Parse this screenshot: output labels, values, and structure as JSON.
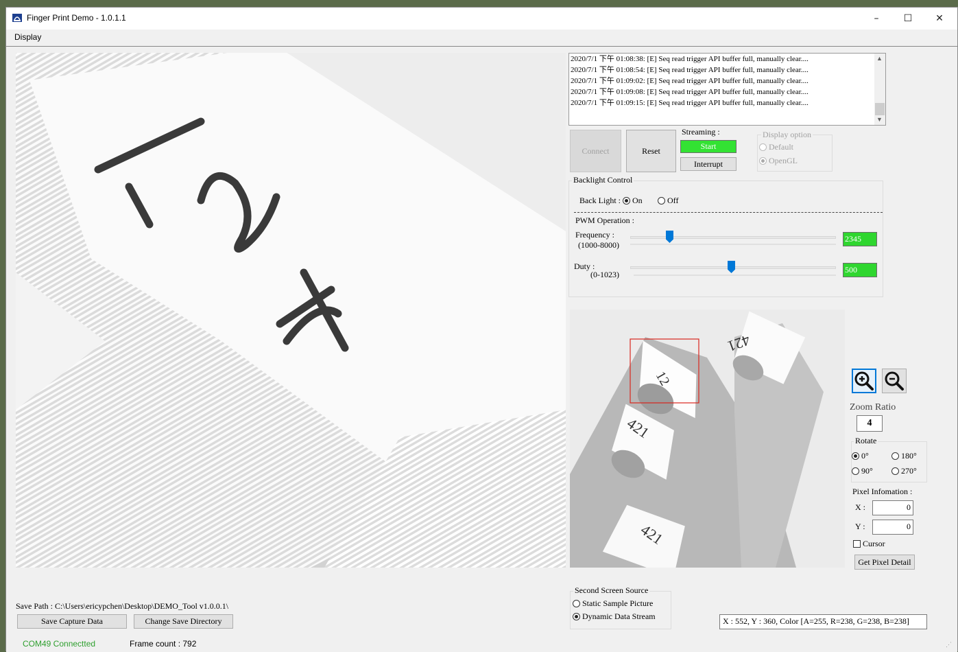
{
  "window": {
    "title": "Finger Print Demo - 1.0.1.1",
    "minimize": "–",
    "maximize": "☐",
    "close": "✕"
  },
  "menu": {
    "display": "Display"
  },
  "log": {
    "lines": [
      "2020/7/1 下午 01:08:38: [E] Seq read trigger API buffer full, manually clear....",
      "2020/7/1 下午 01:08:54: [E] Seq read trigger API buffer full, manually clear....",
      "2020/7/1 下午 01:09:02: [E] Seq read trigger API buffer full, manually clear....",
      "2020/7/1 下午 01:09:08: [E] Seq read trigger API buffer full, manually clear....",
      "2020/7/1 下午 01:09:15: [E] Seq read trigger API buffer full, manually clear...."
    ]
  },
  "controls": {
    "connect": "Connect",
    "reset": "Reset",
    "streaming_label": "Streaming :",
    "start": "Start",
    "interrupt": "Interrupt",
    "display_option_label": "Display option",
    "display_default": "Default",
    "display_opengl": "OpenGL"
  },
  "backlight": {
    "group_label": "Backlight Control",
    "label": "Back Light :",
    "on": "On",
    "off": "Off",
    "selected": "On"
  },
  "pwm": {
    "label": "PWM Operation :",
    "frequency_label": "Frequency :",
    "frequency_range": "(1000-8000)",
    "frequency_value": "2345",
    "frequency_level": 0.19,
    "duty_label": "Duty :",
    "duty_range": "(0-1023)",
    "duty_value": "500",
    "duty_level": 0.49
  },
  "thumbnail_labels": [
    "12",
    "421",
    "421",
    "421"
  ],
  "main_labels": [
    "1",
    "2",
    "4"
  ],
  "zoom": {
    "ratio_label": "Zoom Ratio",
    "ratio_value": "4"
  },
  "rotate": {
    "label": "Rotate",
    "options": [
      "0°",
      "180°",
      "90°",
      "270°"
    ],
    "selected": "0°"
  },
  "pixel": {
    "label": "Pixel Infomation :",
    "x_label": "X :",
    "x_value": "0",
    "y_label": "Y :",
    "y_value": "0",
    "cursor_label": "Cursor",
    "get_detail": "Get Pixel Detail"
  },
  "second_screen": {
    "label": "Second Screen Source",
    "static": "Static Sample Picture",
    "dynamic": "Dynamic Data Stream",
    "selected": "Dynamic Data Stream"
  },
  "save": {
    "path": "Save Path : C:\\Users\\ericypchen\\Desktop\\DEMO_Tool v1.0.0.1\\",
    "capture_button": "Save Capture Data",
    "change_dir_button": "Change Save Directory"
  },
  "pixel_readout": "X : 552, Y : 360, Color [A=255, R=238, G=238, B=238]",
  "status": {
    "connection": "COM49 Connectted",
    "frame_count": "Frame count : 792"
  },
  "colors": {
    "accent": "#0078d7",
    "start_green": "#33e233",
    "value_green": "#2fd62f",
    "roi_red": "#d9251d",
    "status_green": "#2e9f2e"
  }
}
